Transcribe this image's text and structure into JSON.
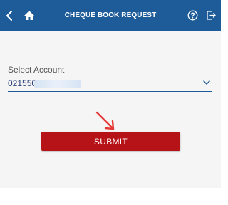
{
  "header": {
    "title": "CHEQUE BOOK REQUEST",
    "background": "#1e5c99",
    "icons": [
      "back-chevron-icon",
      "home-icon",
      "help-icon",
      "logout-icon"
    ]
  },
  "form": {
    "select_label": "Select Account",
    "account_value": "021550",
    "account_masked": true
  },
  "submit": {
    "label": "SUBMIT",
    "color": "#b51318"
  },
  "annotation": {
    "arrow_color": "#e53935"
  }
}
